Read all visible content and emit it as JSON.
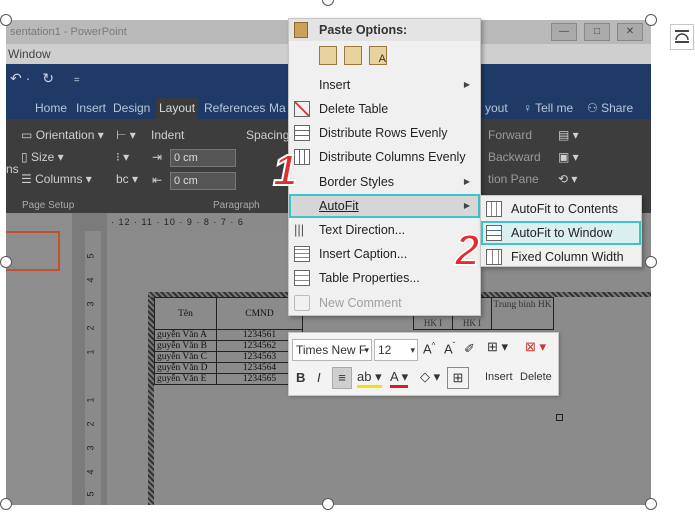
{
  "window": {
    "title": "sentation1 - PowerPoint",
    "menu_window": "Window",
    "qat_undo": "↶ ·",
    "qat_redo": "↻",
    "qat_more": "="
  },
  "tabs": [
    "Home",
    "Insert",
    "Design",
    "Layout",
    "References",
    "Ma",
    "yout"
  ],
  "tell_me": "Tell me",
  "share": "Share",
  "ribbon": {
    "orientation": "Orientation",
    "size": "Size",
    "columns": "Columns",
    "ns": "ns",
    "page_setup": "Page Setup",
    "indent": "Indent",
    "spacing": "Spacing",
    "indent_left": "0 cm",
    "indent_right": "0 cm",
    "paragraph": "Paragraph",
    "forward": "Forward",
    "backward": "Backward",
    "selection_pane": "tion Pane"
  },
  "ruler_text": "· 12 · 11 · 10 · 9 · 8 · 7 · 6",
  "ruler_v": [
    "5",
    "4",
    "3",
    "2",
    "1",
    "",
    "1",
    "2",
    "3",
    "4",
    "5"
  ],
  "doc_table": {
    "headers": [
      "Tên",
      "CMND",
      "Trung bình HK"
    ],
    "rows": [
      [
        "guyễn Văn A",
        "1234561"
      ],
      [
        "guyễn Văn B",
        "1234562"
      ],
      [
        "guyễn Văn C",
        "1234563"
      ],
      [
        "guyễn Văn D",
        "1234564"
      ],
      [
        "guyễn Văn E",
        "1234565"
      ]
    ],
    "partial_headers": [
      "HK I",
      "HK I"
    ]
  },
  "context_menu": {
    "paste_options": "Paste Options:",
    "items": [
      {
        "label": "Insert",
        "icon": "none",
        "submenu": true,
        "disabled": false
      },
      {
        "label": "Delete Table",
        "icon": "delete-table-icon",
        "submenu": false,
        "disabled": false
      },
      {
        "label": "Distribute Rows Evenly",
        "icon": "distribute-rows-icon",
        "submenu": false,
        "disabled": false
      },
      {
        "label": "Distribute Columns Evenly",
        "icon": "distribute-columns-icon",
        "submenu": false,
        "disabled": false
      },
      {
        "label": "Border Styles",
        "icon": "none",
        "submenu": true,
        "disabled": false
      },
      {
        "label": "AutoFit",
        "icon": "none",
        "submenu": true,
        "disabled": false,
        "highlighted": true
      },
      {
        "label": "Text Direction...",
        "icon": "text-direction-icon",
        "submenu": false,
        "disabled": false
      },
      {
        "label": "Insert Caption...",
        "icon": "insert-caption-icon",
        "submenu": false,
        "disabled": false
      },
      {
        "label": "Table Properties...",
        "icon": "table-properties-icon",
        "submenu": false,
        "disabled": false
      },
      {
        "label": "New Comment",
        "icon": "new-comment-icon",
        "submenu": false,
        "disabled": true
      }
    ]
  },
  "autofit_submenu": [
    {
      "label": "AutoFit to Contents",
      "highlighted": false
    },
    {
      "label": "AutoFit to Window",
      "highlighted": true
    },
    {
      "label": "Fixed Column Width",
      "highlighted": false
    }
  ],
  "mini_toolbar": {
    "font": "Times New F",
    "size": "12",
    "insert": "Insert",
    "delete": "Delete"
  },
  "annotations": [
    "1",
    "2"
  ],
  "colors": {
    "highlight": "#3ec3c8",
    "annotation": "#e02d2d",
    "ribbon_blue": "#1f3a66"
  }
}
